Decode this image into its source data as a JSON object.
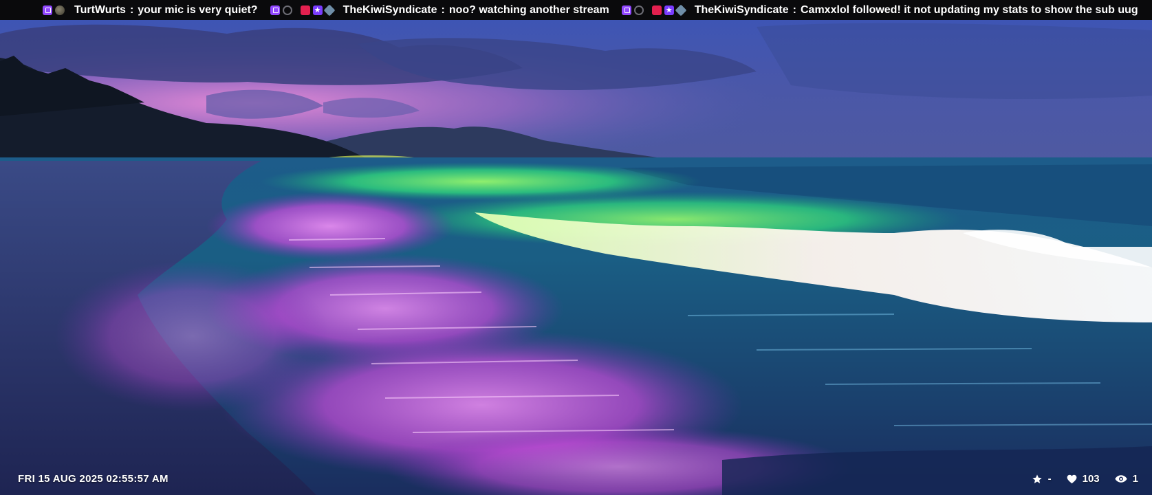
{
  "ticker": {
    "messages": [
      {
        "user": "TurtWurts",
        "separator": ":",
        "text": "your mic is very quiet?",
        "badges": [
          "twitch-badge-icon",
          "avatar-badge-icon"
        ]
      },
      {
        "user": "TheKiwiSyndicate",
        "separator": ":",
        "text": "noo?  watching another stream",
        "badges": [
          "twitch-badge-icon",
          "moderator-badge-icon",
          "video-badge-icon",
          "star-badge-icon",
          "gem-badge-icon"
        ]
      },
      {
        "user": "TheKiwiSyndicate",
        "separator": ":",
        "text": "Camxxlol followed!  it not updating my stats to show the sub uug",
        "badges": [
          "twitch-badge-icon",
          "moderator-badge-icon",
          "video-badge-icon",
          "star-badge-icon",
          "gem-badge-icon"
        ]
      }
    ]
  },
  "overlay": {
    "datetime": "FRI 15 AUG 2025 02:55:57 AM",
    "stats": {
      "favorites": "-",
      "likes": "103",
      "viewers": "1"
    }
  },
  "colors": {
    "ticker_bg": "#0a0a0c",
    "twitch_purple": "#9147ff",
    "sky_top": "#2a3a8c",
    "sunset_pink": "#c472c8",
    "wave_green": "#3cff7a",
    "sand_purple": "#c04bd6"
  }
}
